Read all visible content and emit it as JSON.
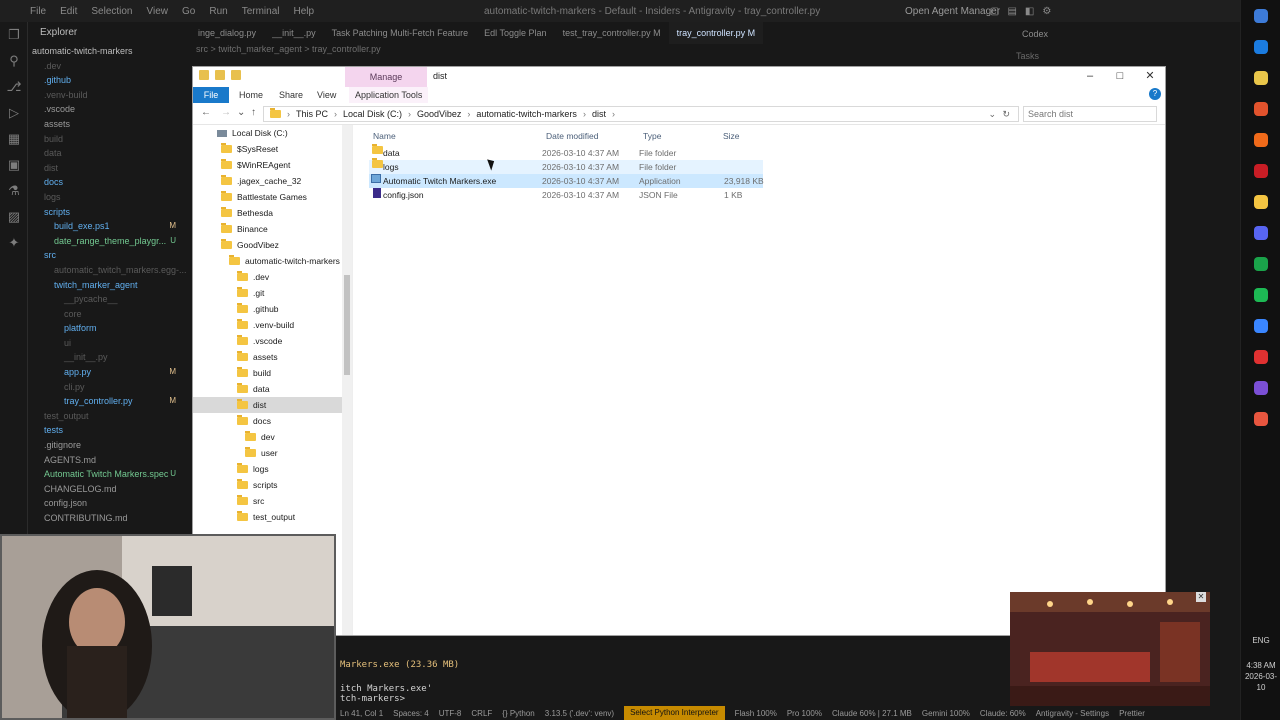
{
  "ide": {
    "menu": [
      "File",
      "Edit",
      "Selection",
      "View",
      "Go",
      "Run",
      "Terminal",
      "Help"
    ],
    "window_title": "automatic-twitch-markers - Default - Insiders - Antigravity - tray_controller.py",
    "agent_manager": "Open Agent Manager",
    "explorer_header": "Explorer",
    "project_name": "automatic-twitch-markers",
    "tree": [
      {
        "label": ".dev",
        "color": "#5a5a5a",
        "indent": 1,
        "status": ""
      },
      {
        "label": ".github",
        "color": "#61afef",
        "indent": 1,
        "status": ""
      },
      {
        "label": ".venv-build",
        "color": "#5a5a5a",
        "indent": 1,
        "status": ""
      },
      {
        "label": ".vscode",
        "color": "#9a9a9a",
        "indent": 1,
        "status": ""
      },
      {
        "label": "assets",
        "color": "#9a9a9a",
        "indent": 1,
        "status": ""
      },
      {
        "label": "build",
        "color": "#5a5a5a",
        "indent": 1,
        "status": ""
      },
      {
        "label": "data",
        "color": "#5a5a5a",
        "indent": 1,
        "status": ""
      },
      {
        "label": "dist",
        "color": "#5a5a5a",
        "indent": 1,
        "status": ""
      },
      {
        "label": "docs",
        "color": "#61afef",
        "indent": 1,
        "status": ""
      },
      {
        "label": "logs",
        "color": "#5a5a5a",
        "indent": 1,
        "status": ""
      },
      {
        "label": "scripts",
        "color": "#61afef",
        "indent": 1,
        "status": ""
      },
      {
        "label": "build_exe.ps1",
        "color": "#61afef",
        "indent": 2,
        "status": "M"
      },
      {
        "label": "date_range_theme_playgr...",
        "color": "#73c991",
        "indent": 2,
        "status": "U"
      },
      {
        "label": "src",
        "color": "#61afef",
        "indent": 1,
        "status": ""
      },
      {
        "label": "automatic_twitch_markers.egg-...",
        "color": "#5a5a5a",
        "indent": 2,
        "status": ""
      },
      {
        "label": "twitch_marker_agent",
        "color": "#61afef",
        "indent": 2,
        "status": ""
      },
      {
        "label": "__pycache__",
        "color": "#5a5a5a",
        "indent": 3,
        "status": ""
      },
      {
        "label": "core",
        "color": "#5a5a5a",
        "indent": 3,
        "status": ""
      },
      {
        "label": "platform",
        "color": "#61afef",
        "indent": 3,
        "status": ""
      },
      {
        "label": "ui",
        "color": "#5a5a5a",
        "indent": 3,
        "status": ""
      },
      {
        "label": "__init__.py",
        "color": "#5a5a5a",
        "indent": 3,
        "status": ""
      },
      {
        "label": "app.py",
        "color": "#61afef",
        "indent": 3,
        "status": "M"
      },
      {
        "label": "cli.py",
        "color": "#5a5a5a",
        "indent": 3,
        "status": ""
      },
      {
        "label": "tray_controller.py",
        "color": "#61afef",
        "indent": 3,
        "status": "M"
      },
      {
        "label": "test_output",
        "color": "#5a5a5a",
        "indent": 1,
        "status": ""
      },
      {
        "label": "tests",
        "color": "#61afef",
        "indent": 1,
        "status": ""
      },
      {
        "label": ".gitignore",
        "color": "#9a9a9a",
        "indent": 1,
        "status": ""
      },
      {
        "label": "AGENTS.md",
        "color": "#9a9a9a",
        "indent": 1,
        "status": ""
      },
      {
        "label": "Automatic Twitch Markers.spec",
        "color": "#73c991",
        "indent": 1,
        "status": "U"
      },
      {
        "label": "CHANGELOG.md",
        "color": "#9a9a9a",
        "indent": 1,
        "status": ""
      },
      {
        "label": "config.json",
        "color": "#9a9a9a",
        "indent": 1,
        "status": ""
      },
      {
        "label": "CONTRIBUTING.md",
        "color": "#9a9a9a",
        "indent": 1,
        "status": ""
      }
    ],
    "tabs": [
      {
        "label": "inge_dialog.py",
        "active": false
      },
      {
        "label": "__init__.py",
        "active": false
      },
      {
        "label": "Task  Patching Multi-Fetch Feature",
        "active": false
      },
      {
        "label": "Edl Toggle Plan",
        "active": false
      },
      {
        "label": "test_tray_controller.py M",
        "active": false
      },
      {
        "label": "tray_controller.py M",
        "active": true
      }
    ],
    "breadcrumb": "src > twitch_marker_agent > tray_controller.py",
    "codex": {
      "title": "Codex",
      "tasks": "Tasks"
    },
    "terminal_lines": [
      "Markers.exe (23.36 MB)",
      "itch Markers.exe'",
      "tch-markers> "
    ],
    "status_items": [
      "Ln 41, Col 1",
      "Spaces: 4",
      "UTF-8",
      "CRLF",
      "{} Python",
      "3.13.5 ('.dev': venv)"
    ],
    "status_python": "Select Python Interpreter",
    "status_right": [
      "Flash 100%",
      "Pro 100%",
      "Claude 60% | 27.1 MB",
      "Gemini 100%",
      "Claude: 60%",
      "Antigravity - Settings",
      "Prettier"
    ]
  },
  "explorer_window": {
    "manage_tab": "Manage",
    "title": "dist",
    "ribbon": {
      "file": "File",
      "home": "Home",
      "share": "Share",
      "view": "View",
      "app_tools": "Application Tools",
      "help": "?"
    },
    "path": [
      "This PC",
      "Local Disk (C:)",
      "GoodVibez",
      "automatic-twitch-markers",
      "dist"
    ],
    "search_placeholder": "Search dist",
    "nav": [
      {
        "label": "Local Disk (C:)",
        "level": 0,
        "selected": false,
        "drive": true
      },
      {
        "label": "$SysReset",
        "level": 1,
        "selected": false
      },
      {
        "label": "$WinREAgent",
        "level": 1,
        "selected": false
      },
      {
        "label": ".jagex_cache_32",
        "level": 1,
        "selected": false
      },
      {
        "label": "Battlestate Games",
        "level": 1,
        "selected": false
      },
      {
        "label": "Bethesda",
        "level": 1,
        "selected": false
      },
      {
        "label": "Binance",
        "level": 1,
        "selected": false
      },
      {
        "label": "GoodVibez",
        "level": 1,
        "selected": false
      },
      {
        "label": "automatic-twitch-markers",
        "level": 2,
        "selected": false
      },
      {
        "label": ".dev",
        "level": 3,
        "selected": false
      },
      {
        "label": ".git",
        "level": 3,
        "selected": false
      },
      {
        "label": ".github",
        "level": 3,
        "selected": false
      },
      {
        "label": ".venv-build",
        "level": 3,
        "selected": false
      },
      {
        "label": ".vscode",
        "level": 3,
        "selected": false
      },
      {
        "label": "assets",
        "level": 3,
        "selected": false
      },
      {
        "label": "build",
        "level": 3,
        "selected": false
      },
      {
        "label": "data",
        "level": 3,
        "selected": false
      },
      {
        "label": "dist",
        "level": 3,
        "selected": true
      },
      {
        "label": "docs",
        "level": 3,
        "selected": false
      },
      {
        "label": "dev",
        "level": 4,
        "selected": false
      },
      {
        "label": "user",
        "level": 4,
        "selected": false
      },
      {
        "label": "logs",
        "level": 3,
        "selected": false
      },
      {
        "label": "scripts",
        "level": 3,
        "selected": false
      },
      {
        "label": "src",
        "level": 3,
        "selected": false
      },
      {
        "label": "test_output",
        "level": 3,
        "selected": false
      }
    ],
    "columns": {
      "name": "Name",
      "date": "Date modified",
      "type": "Type",
      "size": "Size"
    },
    "files": [
      {
        "name": "data",
        "date": "2026-03-10 4:37 AM",
        "type": "File folder",
        "size": "",
        "kind": "folder",
        "state": ""
      },
      {
        "name": "logs",
        "date": "2026-03-10 4:37 AM",
        "type": "File folder",
        "size": "",
        "kind": "folder",
        "state": "hover"
      },
      {
        "name": "Automatic Twitch Markers.exe",
        "date": "2026-03-10 4:37 AM",
        "type": "Application",
        "size": "23,918 KB",
        "kind": "app",
        "state": "sel"
      },
      {
        "name": "config.json",
        "date": "2026-03-10 4:37 AM",
        "type": "JSON File",
        "size": "1 KB",
        "kind": "json",
        "state": ""
      }
    ]
  },
  "taskbar": {
    "lang": "ENG",
    "time": "4:38 AM",
    "date": "2026-03-10",
    "apps": [
      "#3d7bd8",
      "#1b7ce0",
      "#e9c64a",
      "#e2532d",
      "#f06a1a",
      "#c81d25",
      "#f4c542",
      "#5865f2",
      "#1aa34a",
      "#1db954",
      "#3a86ff",
      "#e03131",
      "#7b4fd6",
      "#e8563f"
    ]
  }
}
